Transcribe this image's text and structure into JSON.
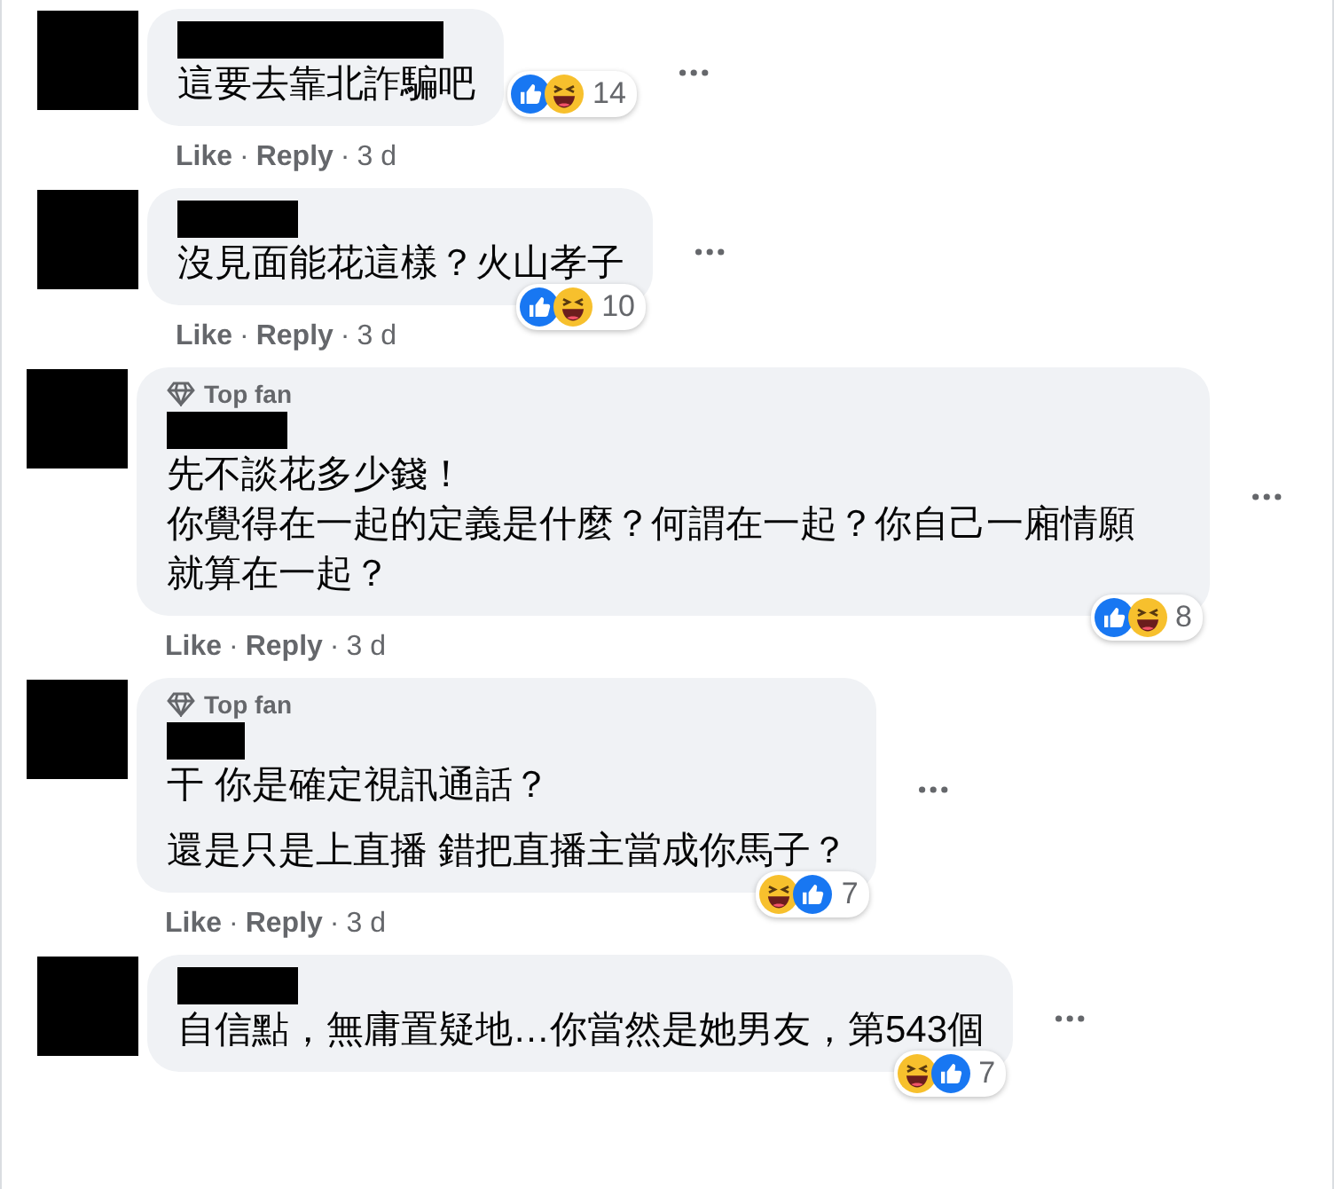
{
  "comments": [
    {
      "lines": [
        "這要去靠北詐騙吧"
      ],
      "reactions": [
        {
          "kind": "like"
        },
        {
          "kind": "haha"
        }
      ],
      "count": "14",
      "actions": [
        {
          "kind": "like",
          "text": "Like"
        },
        {
          "kind": "separator",
          "text": "·"
        },
        {
          "kind": "reply",
          "text": "Reply"
        },
        {
          "kind": "separator",
          "text": "·"
        },
        {
          "kind": "time",
          "text": "3 d"
        }
      ]
    },
    {
      "lines": [
        "沒見面能花這樣？火山孝子"
      ],
      "reactions": [
        {
          "kind": "like"
        },
        {
          "kind": "haha"
        }
      ],
      "count": "10",
      "actions": [
        {
          "kind": "like",
          "text": "Like"
        },
        {
          "kind": "separator",
          "text": "·"
        },
        {
          "kind": "reply",
          "text": "Reply"
        },
        {
          "kind": "separator",
          "text": "·"
        },
        {
          "kind": "time",
          "text": "3 d"
        }
      ]
    },
    {
      "top_fan": "Top fan",
      "lines": [
        "先不談花多少錢！",
        "你覺得在一起的定義是什麼？何謂在一起？你自己一廂情願就算在一起？"
      ],
      "reactions": [
        {
          "kind": "like"
        },
        {
          "kind": "haha"
        }
      ],
      "count": "8",
      "actions": [
        {
          "kind": "like",
          "text": "Like"
        },
        {
          "kind": "separator",
          "text": "·"
        },
        {
          "kind": "reply",
          "text": "Reply"
        },
        {
          "kind": "separator",
          "text": "·"
        },
        {
          "kind": "time",
          "text": "3 d"
        }
      ]
    },
    {
      "top_fan": "Top fan",
      "lines": [
        "干 你是確定視訊通話？",
        "還是只是上直播 錯把直播主當成你馬子？"
      ],
      "reactions": [
        {
          "kind": "haha"
        },
        {
          "kind": "like"
        }
      ],
      "count": "7",
      "actions": [
        {
          "kind": "like",
          "text": "Like"
        },
        {
          "kind": "separator",
          "text": "·"
        },
        {
          "kind": "reply",
          "text": "Reply"
        },
        {
          "kind": "separator",
          "text": "·"
        },
        {
          "kind": "time",
          "text": "3 d"
        }
      ]
    },
    {
      "lines": [
        "自信點，無庸置疑地…你當然是她男友，第543個"
      ],
      "reactions": [
        {
          "kind": "haha"
        },
        {
          "kind": "like"
        }
      ],
      "count": "7"
    }
  ]
}
